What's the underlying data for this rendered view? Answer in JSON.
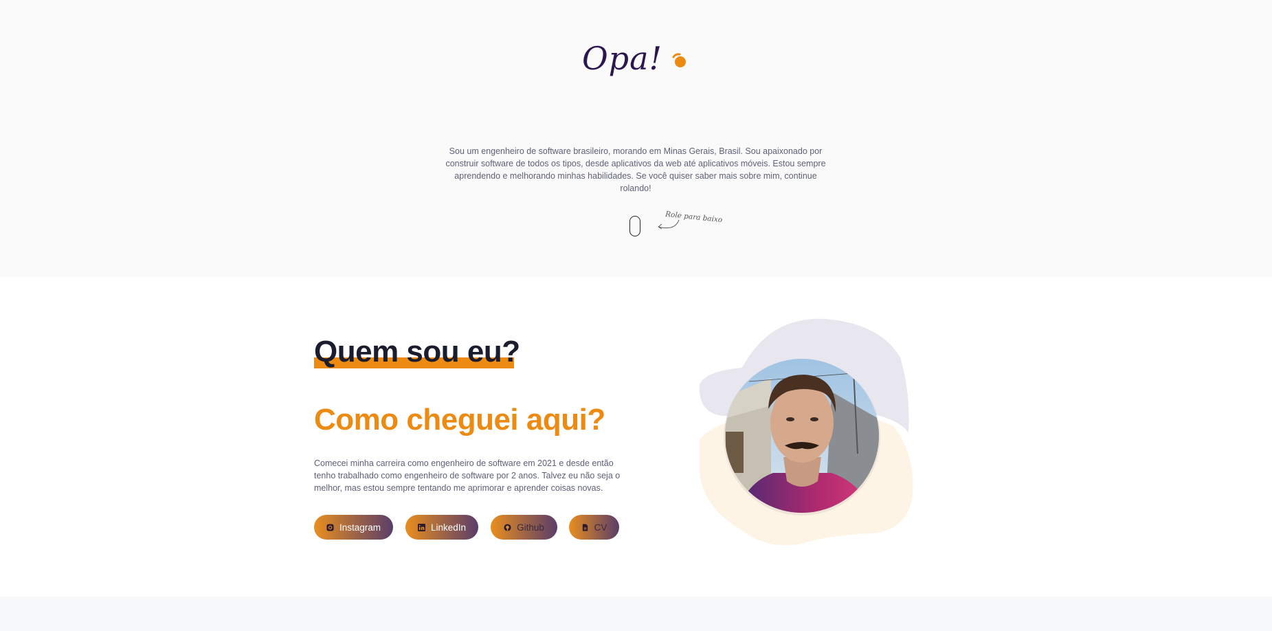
{
  "hero": {
    "title": "Opa!",
    "intro": "Sou um engenheiro de software brasileiro, morando em Minas Gerais, Brasil. Sou apaixonado por construir software de todos os tipos, desde aplicativos da web até aplicativos móveis. Estou sempre aprendendo e melhorando minhas habilidades. Se você quiser saber mais sobre mim, continue rolando!",
    "scroll_hint": "Role para baixo"
  },
  "about": {
    "title": "Quem sou eu?",
    "subtitle": "Como cheguei aqui?",
    "description": "Comecei minha carreira como engenheiro de software em 2021 e desde então tenho trabalhado como engenheiro de software por 2 anos. Talvez eu não seja o melhor, mas estou sempre tentando me aprimorar e aprender coisas novas."
  },
  "buttons": [
    {
      "label": "Instagram",
      "icon": "instagram-icon"
    },
    {
      "label": "LinkedIn",
      "icon": "linkedin-icon"
    },
    {
      "label": "Github",
      "icon": "github-icon"
    },
    {
      "label": "CV",
      "icon": "document-icon"
    }
  ],
  "colors": {
    "accent": "#ec8a12",
    "brand_dark": "#2b1650",
    "button_gradient_end": "#5a3d69"
  }
}
